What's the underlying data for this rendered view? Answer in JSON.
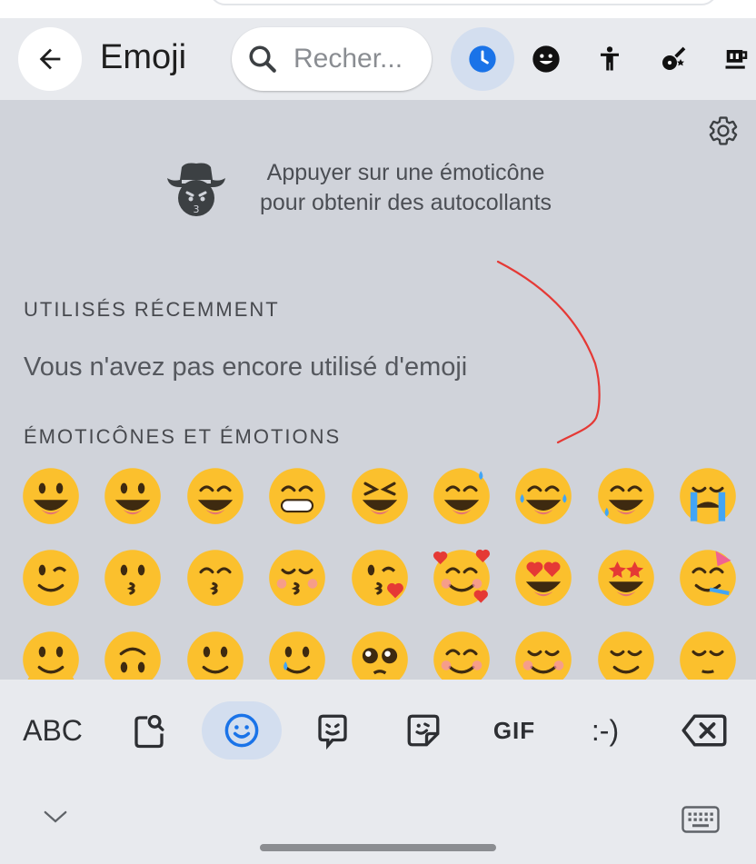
{
  "header": {
    "title": "Emoji",
    "search_placeholder": "Recher..."
  },
  "categories": [
    "recent-icon",
    "smileys-icon",
    "people-icon",
    "activities-icon",
    "food-icon"
  ],
  "sticker_hint": {
    "line1": "Appuyer sur une émoticône",
    "line2": "pour obtenir des autocollants"
  },
  "sections": {
    "recent": {
      "title": "UTILISÉS RÉCEMMENT",
      "empty_message": "Vous n'avez pas encore utilisé d'emoji"
    },
    "smileys": {
      "title": "ÉMOTICÔNES ET ÉMOTIONS"
    }
  },
  "emoji_rows": [
    [
      "grinning-face",
      "grinning-face-big-eyes",
      "grinning-face-smiling-eyes",
      "beaming-face",
      "grinning-squinting-face",
      "grinning-face-sweat",
      "face-tears-of-joy",
      "rolling-on-floor-laughing",
      "loudly-crying-face"
    ],
    [
      "winking-face",
      "kissing-face",
      "kissing-face-smiling-eyes",
      "kissing-face-closed-eyes",
      "face-blowing-kiss",
      "smiling-face-with-hearts",
      "smiling-face-heart-eyes",
      "star-struck",
      "partying-face"
    ],
    [
      "melting-face",
      "upside-down-face",
      "slightly-smiling-face",
      "face-holding-back-tears",
      "pleading-face",
      "smiling-face-smiling-eyes",
      "smiling-face",
      "relieved-face",
      "face-exhaling"
    ]
  ],
  "keyboard_bar": {
    "abc_label": "ABC",
    "gif_label": "GIF",
    "emoticon_label": ":-)"
  },
  "colors": {
    "accent": "#1a73e8",
    "active_bg": "#d3deef",
    "panel_bg": "#d0d3da",
    "annotation": "#e53935",
    "emoji_yellow": "#fbc02d"
  }
}
